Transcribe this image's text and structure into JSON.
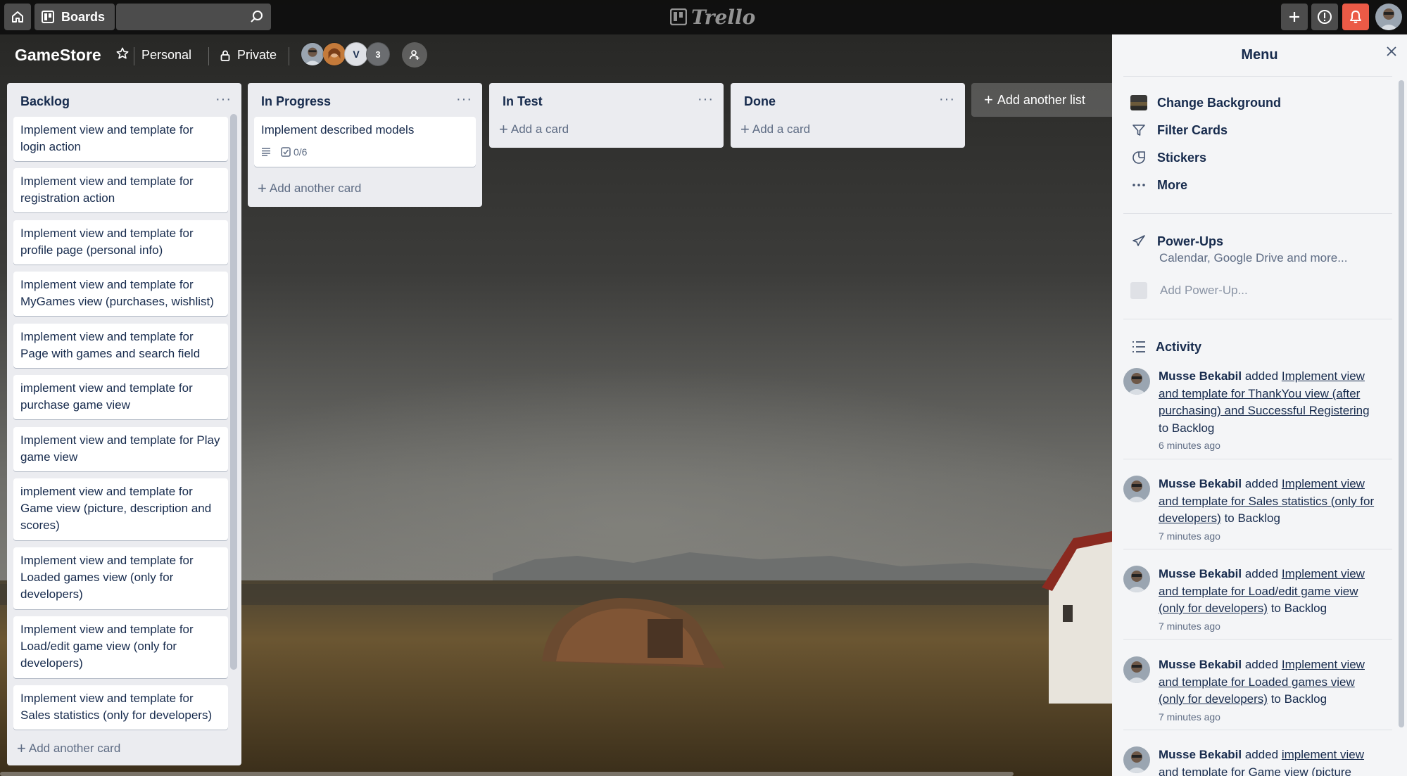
{
  "topnav": {
    "boards_label": "Boards",
    "search_placeholder": "",
    "logo_text": "Trello"
  },
  "board": {
    "title": "GameStore",
    "team": "Personal",
    "visibility": "Private",
    "member_initial": "V",
    "member_overflow": "3"
  },
  "lists": [
    {
      "title": "Backlog",
      "menu": "···",
      "cards": [
        "Implement view and template for login action",
        "Implement view and template for registration action",
        "Implement view and template for profile page (personal info)",
        "Implement view and template for MyGames view (purchases, wishlist)",
        "Implement view and template for Page with games and search field",
        "implement view and template for purchase game view",
        "Implement view and template for Play game view",
        "implement view and template for Game view (picture, description and scores)",
        "Implement view and template for Loaded games view (only for developers)",
        "Implement view and template for Load/edit game view (only for developers)",
        "Implement view and template for Sales statistics (only for developers)"
      ],
      "add_label": "Add another card"
    },
    {
      "title": "In Progress",
      "menu": "···",
      "cards": [
        "Implement described models"
      ],
      "checklist": "0/6",
      "add_label": "Add another card"
    },
    {
      "title": "In Test",
      "menu": "···",
      "add_label": "Add a card"
    },
    {
      "title": "Done",
      "menu": "···",
      "add_label": "Add a card"
    }
  ],
  "add_list_label": "Add another list",
  "menu": {
    "title": "Menu",
    "items": [
      "Change Background",
      "Filter Cards",
      "Stickers",
      "More"
    ],
    "powerups_title": "Power-Ups",
    "powerups_sub": "Calendar, Google Drive and more...",
    "add_powerup": "Add Power-Up...",
    "activity_title": "Activity",
    "activity": [
      {
        "user": "Musse Bekabil",
        "verb": "added",
        "card": "Implement view and template for ThankYou view (after purchasing) and Successful Registering",
        "dest": "to Backlog",
        "time": "6 minutes ago"
      },
      {
        "user": "Musse Bekabil",
        "verb": "added",
        "card": "Implement view and template for Sales statistics (only for developers)",
        "dest": "to Backlog",
        "time": "7 minutes ago"
      },
      {
        "user": "Musse Bekabil",
        "verb": "added",
        "card": "Implement view and template for Load/edit game view (only for developers)",
        "dest": "to Backlog",
        "time": "7 minutes ago"
      },
      {
        "user": "Musse Bekabil",
        "verb": "added",
        "card": "Implement view and template for Loaded games view (only for developers)",
        "dest": "to Backlog",
        "time": "7 minutes ago"
      },
      {
        "user": "Musse Bekabil",
        "verb": "added",
        "card": "implement view and template for Game view (picture",
        "dest": "",
        "time": ""
      }
    ]
  },
  "colors": {
    "list_bg": "#ebecf0",
    "notification": "#eb5a46",
    "menu_bg": "#f4f5f7",
    "text": "#172b4d"
  }
}
